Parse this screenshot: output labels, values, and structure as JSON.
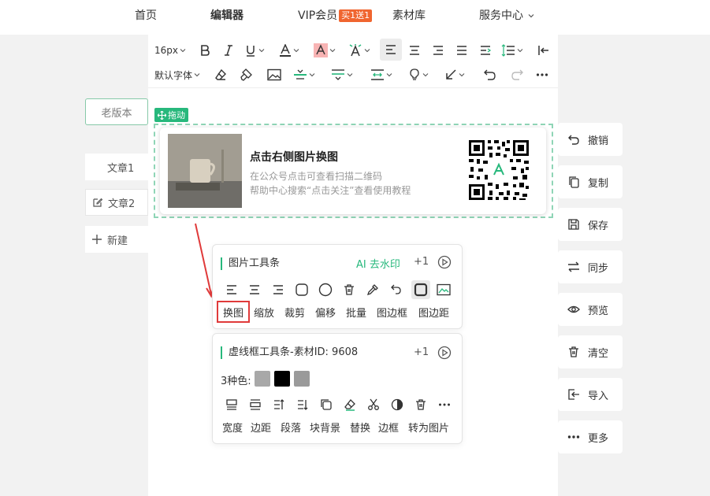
{
  "nav": {
    "home": "首页",
    "editor": "编辑器",
    "vip": "VIP会员",
    "vip_badge": "买1送1",
    "materials": "素材库",
    "service": "服务中心"
  },
  "left": {
    "old_version": "老版本",
    "article1": "文章1",
    "article2": "文章2",
    "new": "新建"
  },
  "toolbar": {
    "font_size": "16px",
    "font_family": "默认字体"
  },
  "drag_tag": "拖动",
  "card": {
    "title": "点击右侧图片换图",
    "line1": "在公众号点击可查看扫描二维码",
    "line2": "帮助中心搜索“点击关注”查看使用教程"
  },
  "image_toolbar": {
    "title": "图片工具条",
    "ai": "AI 去水印",
    "plus": "+1",
    "labels": [
      "换图",
      "缩放",
      "裁剪",
      "偏移",
      "批量",
      "图边框",
      "图边距"
    ]
  },
  "frame_toolbar": {
    "title": "虚线框工具条-素材ID: 9608",
    "plus": "+1",
    "colors_label": "3种色:",
    "colors": [
      "#a8a8a8",
      "#000000",
      "#9a9a9a"
    ],
    "labels": [
      "宽度",
      "边距",
      "段落",
      "块背景",
      "替换",
      "边框",
      "转为图片"
    ]
  },
  "right": {
    "undo": "撤销",
    "copy": "复制",
    "save": "保存",
    "sync": "同步",
    "preview": "预览",
    "clear": "清空",
    "import": "导入",
    "more": "更多"
  },
  "accent": "#27b87c",
  "highlight": "#e03a3a"
}
